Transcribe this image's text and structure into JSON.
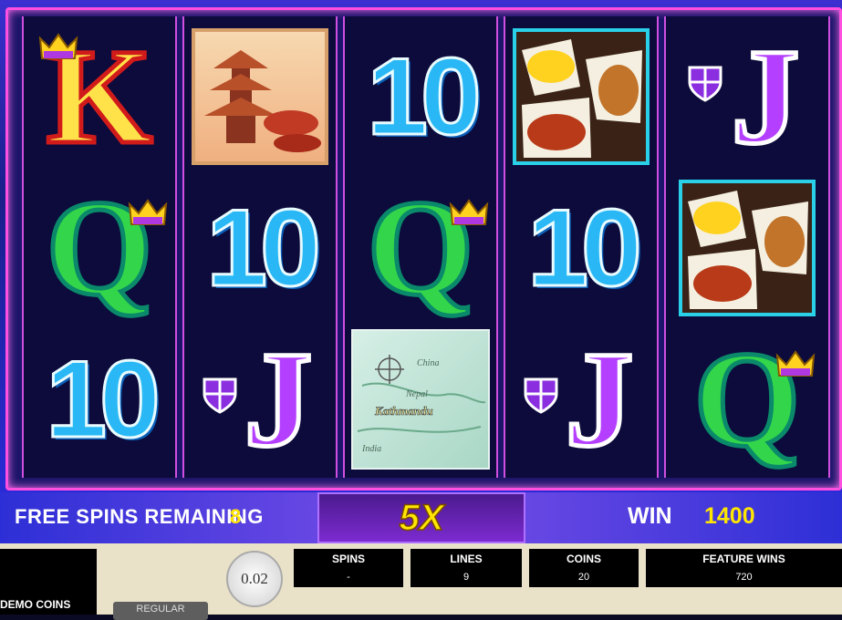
{
  "reels": [
    [
      {
        "type": "K"
      },
      {
        "type": "Q"
      },
      {
        "type": "10"
      }
    ],
    [
      {
        "type": "temple"
      },
      {
        "type": "10"
      },
      {
        "type": "J"
      }
    ],
    [
      {
        "type": "10"
      },
      {
        "type": "Q"
      },
      {
        "type": "map"
      }
    ],
    [
      {
        "type": "jewels"
      },
      {
        "type": "10"
      },
      {
        "type": "J"
      }
    ],
    [
      {
        "type": "J"
      },
      {
        "type": "jewels"
      },
      {
        "type": "Q"
      }
    ]
  ],
  "symbols": {
    "K": "K",
    "Q": "Q",
    "J": "J",
    "ten": "10"
  },
  "map_labels": {
    "china": "China",
    "nepal": "Nepal",
    "kathmandu": "Kathmandu",
    "india": "India"
  },
  "status_bar": {
    "free_spins_label": "FREE SPINS REMAINING",
    "free_spins_value": "8",
    "multiplier": "5X",
    "win_label": "WIN",
    "win_value": "1400"
  },
  "panel": {
    "demo_coins_label": "DEMO COINS",
    "regular_button": "REGULAR",
    "coin_value": "0.02",
    "stats": [
      {
        "label": "SPINS",
        "value": "-"
      },
      {
        "label": "LINES",
        "value": "9"
      },
      {
        "label": "COINS",
        "value": "20"
      },
      {
        "label": "FEATURE WINS",
        "value": "720"
      }
    ]
  },
  "colors": {
    "frame": "#ff4fe0",
    "accent": "#ffe600",
    "ten": "#29b8f5",
    "queen": "#33d64a",
    "jack": "#b43fff",
    "king": "#ffe24a"
  }
}
